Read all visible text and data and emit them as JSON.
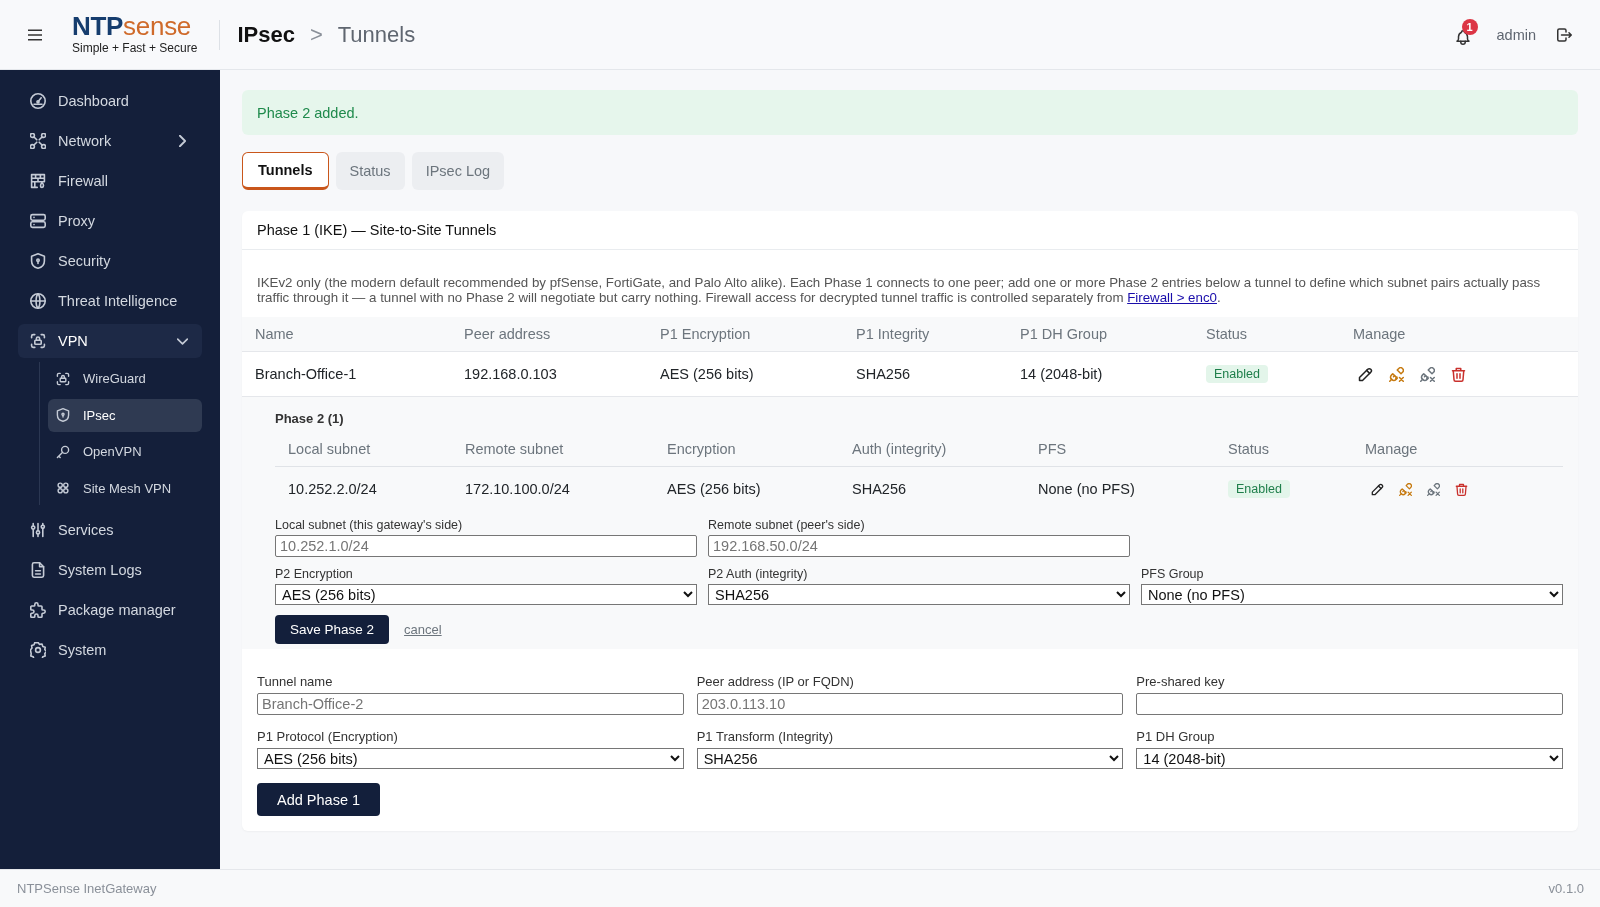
{
  "header": {
    "logo": {
      "primary": "NTP",
      "secondary": "sense",
      "tagline": "Simple + Fast + Secure"
    },
    "breadcrumb": {
      "section": "IPsec",
      "separator": ">",
      "page": "Tunnels"
    },
    "notifications": {
      "count": "1"
    },
    "user": "admin"
  },
  "sidebar": {
    "items": [
      {
        "label": "Dashboard",
        "selected": false
      },
      {
        "label": "Network",
        "selected": false,
        "expanded": false
      },
      {
        "label": "Firewall",
        "selected": false
      },
      {
        "label": "Proxy",
        "selected": false
      },
      {
        "label": "Security",
        "selected": false
      },
      {
        "label": "Threat Intelligence",
        "selected": false
      },
      {
        "label": "VPN",
        "selected": true,
        "expanded": true,
        "children": [
          {
            "label": "WireGuard",
            "selected": false
          },
          {
            "label": "IPsec",
            "selected": true
          },
          {
            "label": "OpenVPN",
            "selected": false
          },
          {
            "label": "Site Mesh VPN",
            "selected": false
          }
        ]
      },
      {
        "label": "Services",
        "selected": false
      },
      {
        "label": "System Logs",
        "selected": false
      },
      {
        "label": "Package manager",
        "selected": false
      },
      {
        "label": "System",
        "selected": false
      }
    ]
  },
  "alert": {
    "message": "Phase 2 added."
  },
  "tabs": [
    {
      "label": "Tunnels",
      "selected": true
    },
    {
      "label": "Status",
      "selected": false
    },
    {
      "label": "IPsec Log",
      "selected": false
    }
  ],
  "tunnels_card": {
    "title": "Phase 1 (IKE) — Site-to-Site Tunnels",
    "description": {
      "text": "IKEv2 only (the modern default recommended by pfSense, FortiGate, and Palo Alto alike). Each Phase 1 connects to one peer; add one or more Phase 2 entries below a tunnel to define which subnet pairs actually pass traffic through it — a tunnel with no Phase 2 will negotiate but carry nothing. Firewall access for decrypted tunnel traffic is controlled separately from ",
      "link": "Firewall > enc0",
      "after": "."
    },
    "table": {
      "columns": [
        "Name",
        "Peer address",
        "P1 Encryption",
        "P1 Integrity",
        "P1 DH Group",
        "Status",
        "Manage"
      ],
      "rows": [
        {
          "cells": [
            "Branch-Office-1",
            "192.168.0.103",
            "AES (256 bits)",
            "SHA256",
            "14 (2048-bit)"
          ],
          "status": "Enabled",
          "phase2": {
            "title": "Phase 2 (1)",
            "columns": [
              "Local subnet",
              "Remote subnet",
              "Encryption",
              "Auth (integrity)",
              "PFS",
              "Status",
              "Manage"
            ],
            "rows": [
              {
                "cells": [
                  "10.252.2.0/24",
                  "172.10.100.0/24",
                  "AES (256 bits)",
                  "SHA256",
                  "None (no PFS)"
                ],
                "status": "Enabled"
              }
            ],
            "form": {
              "groups": [
                {
                  "fields": [
                    {
                      "kind": "input",
                      "label": "Local subnet (this gateway's side)",
                      "placeholder": "10.252.1.0/24"
                    },
                    {
                      "kind": "input",
                      "label": "Remote subnet (peer's side)",
                      "placeholder": "192.168.50.0/24"
                    }
                  ]
                },
                {
                  "fields": [
                    {
                      "kind": "select",
                      "label": "P2 Encryption",
                      "value": "AES (256 bits)"
                    },
                    {
                      "kind": "select",
                      "label": "P2 Auth (integrity)",
                      "value": "SHA256"
                    },
                    {
                      "kind": "select",
                      "label": "PFS Group",
                      "value": "None (no PFS)"
                    }
                  ]
                }
              ],
              "save_button": "Save Phase 2",
              "cancel_link": "cancel"
            }
          }
        }
      ]
    },
    "form": {
      "groups": [
        {
          "fields": [
            {
              "kind": "input",
              "label": "Tunnel name",
              "placeholder": "Branch-Office-2"
            },
            {
              "kind": "input",
              "label": "Peer address (IP or FQDN)",
              "placeholder": "203.0.113.10"
            },
            {
              "kind": "input",
              "label": "Pre-shared key"
            }
          ]
        },
        {
          "fields": [
            {
              "kind": "select",
              "label": "P1 Protocol (Encryption)",
              "value": "AES (256 bits)"
            },
            {
              "kind": "select",
              "label": "P1 Transform (Integrity)",
              "value": "SHA256"
            },
            {
              "kind": "select",
              "label": "P1 DH Group",
              "value": "14 (2048-bit)"
            }
          ]
        }
      ],
      "submit_button": "Add Phase 1"
    }
  },
  "footer": {
    "product": "NTPSense InetGateway",
    "version": "v0.1.0"
  }
}
